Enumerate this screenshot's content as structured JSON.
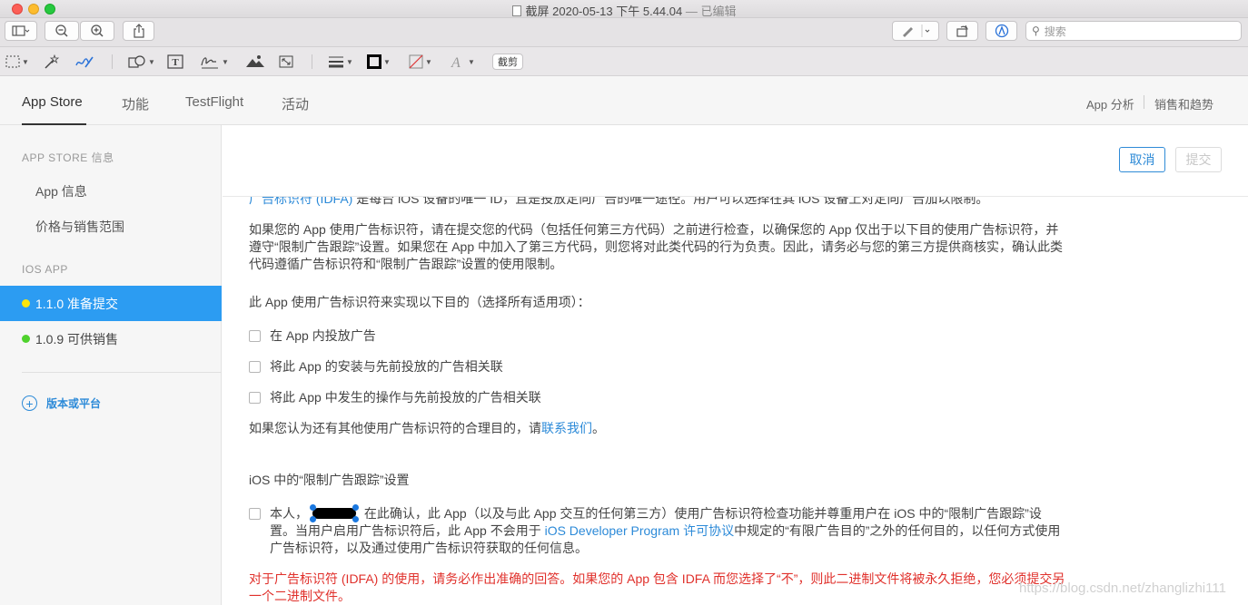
{
  "window": {
    "title": "截屏 2020-05-13 下午 5.44.04",
    "edited": "— 已编辑"
  },
  "toolbar": {
    "search_placeholder": "搜索",
    "crop_label": "截剪"
  },
  "nav": {
    "tabs": [
      "App Store",
      "功能",
      "TestFlight",
      "活动"
    ],
    "right": [
      "App 分析",
      "销售和趋势"
    ]
  },
  "sidebar": {
    "section1": "APP STORE 信息",
    "items": [
      "App 信息",
      "价格与销售范围"
    ],
    "section2": "IOS APP",
    "versions": [
      {
        "label": "1.1.0 准备提交",
        "status_color": "#fce50a"
      },
      {
        "label": "1.0.9 可供销售",
        "status_color": "#4fd22d"
      }
    ],
    "add_label": "版本或平台"
  },
  "actions": {
    "cancel": "取消",
    "submit": "提交"
  },
  "content": {
    "cut_line_blue": "广告标识符 (IDFA)",
    "cut_line_rest": " 是每台 iOS 设备的唯一 ID，且是投放定向广告的唯一途径。用户可以选择在其 iOS 设备上对定向广告加以限制。",
    "para1": "如果您的 App 使用广告标识符，请在提交您的代码（包括任何第三方代码）之前进行检查，以确保您的 App 仅出于以下目的使用广告标识符，并遵守“限制广告跟踪”设置。如果您在 App 中加入了第三方代码，则您将对此类代码的行为负责。因此，请务必与您的第三方提供商核实，确认此类代码遵循广告标识符和“限制广告跟踪”设置的使用限制。",
    "purpose_question": "此 App 使用广告标识符来实现以下目的（选择所有适用项）：",
    "options": [
      "在 App 内投放广告",
      "将此 App 的安装与先前投放的广告相关联",
      "将此 App 中发生的操作与先前投放的广告相关联"
    ],
    "other_purpose_prefix": "如果您认为还有其他使用广告标识符的合理目的，请",
    "contact_link": "联系我们",
    "other_purpose_suffix": "。",
    "limit_title": "iOS 中的“限制广告跟踪”设置",
    "confirm_prefix": "本人，",
    "confirm_mid": " 在此确认，此 App（以及与此 App 交互的任何第三方）使用广告标识符检查功能并尊重用户在 iOS 中的“限制广告跟踪”设置。当用户启用广告标识符后，此 App 不会用于 ",
    "confirm_link": "iOS Developer Program 许可协议",
    "confirm_suffix": "中规定的“有限广告目的”之外的任何目的，以任何方式使用广告标识符，以及通过使用广告标识符获取的任何信息。",
    "warning": "对于广告标识符 (IDFA) 的使用，请务必作出准确的回答。如果您的 App 包含 IDFA 而您选择了“不”，则此二进制文件将被永久拒绝，您必须提交另一个二进制文件。"
  },
  "watermark": "https://blog.csdn.net/zhanglizhi111"
}
